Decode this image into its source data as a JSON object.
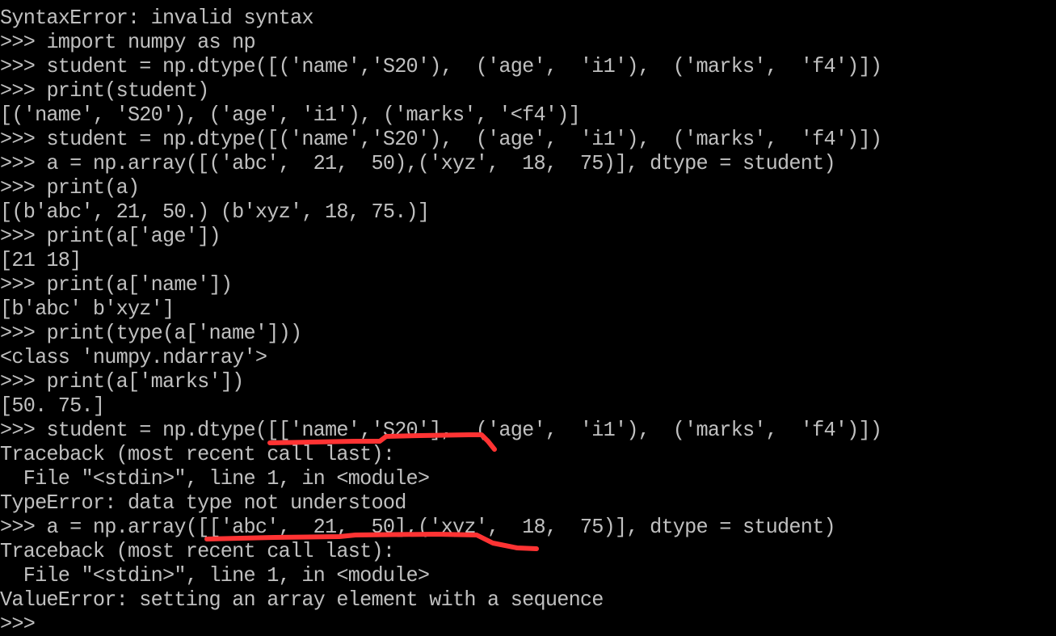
{
  "terminal": {
    "background": "#000000",
    "foreground": "#c0c0c0",
    "annotation_color": "#ff3333",
    "prompt": ">>>",
    "lines": [
      {
        "type": "error",
        "text": "SyntaxError: invalid syntax"
      },
      {
        "type": "input",
        "prompt": ">>> ",
        "text": "import numpy as np"
      },
      {
        "type": "input",
        "prompt": ">>> ",
        "text": "student = np.dtype([('name','S20'),  ('age',  'i1'),  ('marks',  'f4')])"
      },
      {
        "type": "input",
        "prompt": ">>> ",
        "text": "print(student)"
      },
      {
        "type": "output",
        "text": "[('name', 'S20'), ('age', 'i1'), ('marks', '<f4')]"
      },
      {
        "type": "input",
        "prompt": ">>> ",
        "text": "student = np.dtype([('name','S20'),  ('age',  'i1'),  ('marks',  'f4')])"
      },
      {
        "type": "input",
        "prompt": ">>> ",
        "text": "a = np.array([('abc',  21,  50),('xyz',  18,  75)], dtype = student)"
      },
      {
        "type": "input",
        "prompt": ">>> ",
        "text": "print(a)"
      },
      {
        "type": "output",
        "text": "[(b'abc', 21, 50.) (b'xyz', 18, 75.)]"
      },
      {
        "type": "input",
        "prompt": ">>> ",
        "text": "print(a['age'])"
      },
      {
        "type": "output",
        "text": "[21 18]"
      },
      {
        "type": "input",
        "prompt": ">>> ",
        "text": "print(a['name'])"
      },
      {
        "type": "output",
        "text": "[b'abc' b'xyz']"
      },
      {
        "type": "input",
        "prompt": ">>> ",
        "text": "print(type(a['name']))"
      },
      {
        "type": "output",
        "text": "<class 'numpy.ndarray'>"
      },
      {
        "type": "input",
        "prompt": ">>> ",
        "text": "print(a['marks'])"
      },
      {
        "type": "output",
        "text": "[50. 75.]"
      },
      {
        "type": "input",
        "prompt": ">>> ",
        "text": "student = np.dtype([['name','S20'],  ('age',  'i1'),  ('marks',  'f4')])"
      },
      {
        "type": "output",
        "text": "Traceback (most recent call last):"
      },
      {
        "type": "output",
        "text": "  File \"<stdin>\", line 1, in <module>"
      },
      {
        "type": "error",
        "text": "TypeError: data type not understood"
      },
      {
        "type": "input",
        "prompt": ">>> ",
        "text": "a = np.array([['abc',  21,  50],('xyz',  18,  75)], dtype = student)"
      },
      {
        "type": "output",
        "text": "Traceback (most recent call last):"
      },
      {
        "type": "output",
        "text": "  File \"<stdin>\", line 1, in <module>"
      },
      {
        "type": "error",
        "text": "ValueError: setting an array element with a sequence"
      },
      {
        "type": "input",
        "prompt": ">>>",
        "text": ""
      }
    ]
  }
}
